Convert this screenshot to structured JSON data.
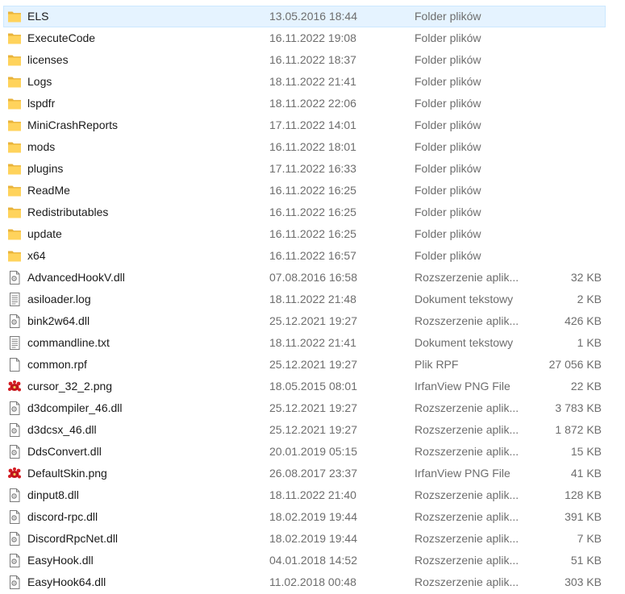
{
  "files": [
    {
      "name": "ELS",
      "date": "13.05.2016 18:44",
      "type": "Folder plików",
      "size": "",
      "icon": "folder-icon",
      "selected": true
    },
    {
      "name": "ExecuteCode",
      "date": "16.11.2022 19:08",
      "type": "Folder plików",
      "size": "",
      "icon": "folder-icon"
    },
    {
      "name": "licenses",
      "date": "16.11.2022 18:37",
      "type": "Folder plików",
      "size": "",
      "icon": "folder-icon"
    },
    {
      "name": "Logs",
      "date": "18.11.2022 21:41",
      "type": "Folder plików",
      "size": "",
      "icon": "folder-icon"
    },
    {
      "name": "lspdfr",
      "date": "18.11.2022 22:06",
      "type": "Folder plików",
      "size": "",
      "icon": "folder-icon"
    },
    {
      "name": "MiniCrashReports",
      "date": "17.11.2022 14:01",
      "type": "Folder plików",
      "size": "",
      "icon": "folder-icon"
    },
    {
      "name": "mods",
      "date": "16.11.2022 18:01",
      "type": "Folder plików",
      "size": "",
      "icon": "folder-icon"
    },
    {
      "name": "plugins",
      "date": "17.11.2022 16:33",
      "type": "Folder plików",
      "size": "",
      "icon": "folder-icon"
    },
    {
      "name": "ReadMe",
      "date": "16.11.2022 16:25",
      "type": "Folder plików",
      "size": "",
      "icon": "folder-icon"
    },
    {
      "name": "Redistributables",
      "date": "16.11.2022 16:25",
      "type": "Folder plików",
      "size": "",
      "icon": "folder-icon"
    },
    {
      "name": "update",
      "date": "16.11.2022 16:25",
      "type": "Folder plików",
      "size": "",
      "icon": "folder-icon"
    },
    {
      "name": "x64",
      "date": "16.11.2022 16:57",
      "type": "Folder plików",
      "size": "",
      "icon": "folder-icon"
    },
    {
      "name": "AdvancedHookV.dll",
      "date": "07.08.2016 16:58",
      "type": "Rozszerzenie aplik...",
      "size": "32 KB",
      "icon": "dll-file-icon"
    },
    {
      "name": "asiloader.log",
      "date": "18.11.2022 21:48",
      "type": "Dokument tekstowy",
      "size": "2 KB",
      "icon": "text-file-icon"
    },
    {
      "name": "bink2w64.dll",
      "date": "25.12.2021 19:27",
      "type": "Rozszerzenie aplik...",
      "size": "426 KB",
      "icon": "dll-file-icon"
    },
    {
      "name": "commandline.txt",
      "date": "18.11.2022 21:41",
      "type": "Dokument tekstowy",
      "size": "1 KB",
      "icon": "text-file-icon"
    },
    {
      "name": "common.rpf",
      "date": "25.12.2021 19:27",
      "type": "Plik RPF",
      "size": "27 056 KB",
      "icon": "blank-file-icon"
    },
    {
      "name": "cursor_32_2.png",
      "date": "18.05.2015 08:01",
      "type": "IrfanView PNG File",
      "size": "22 KB",
      "icon": "irfanview-icon"
    },
    {
      "name": "d3dcompiler_46.dll",
      "date": "25.12.2021 19:27",
      "type": "Rozszerzenie aplik...",
      "size": "3 783 KB",
      "icon": "dll-file-icon"
    },
    {
      "name": "d3dcsx_46.dll",
      "date": "25.12.2021 19:27",
      "type": "Rozszerzenie aplik...",
      "size": "1 872 KB",
      "icon": "dll-file-icon"
    },
    {
      "name": "DdsConvert.dll",
      "date": "20.01.2019 05:15",
      "type": "Rozszerzenie aplik...",
      "size": "15 KB",
      "icon": "dll-file-icon"
    },
    {
      "name": "DefaultSkin.png",
      "date": "26.08.2017 23:37",
      "type": "IrfanView PNG File",
      "size": "41 KB",
      "icon": "irfanview-icon"
    },
    {
      "name": "dinput8.dll",
      "date": "18.11.2022 21:40",
      "type": "Rozszerzenie aplik...",
      "size": "128 KB",
      "icon": "dll-file-icon"
    },
    {
      "name": "discord-rpc.dll",
      "date": "18.02.2019 19:44",
      "type": "Rozszerzenie aplik...",
      "size": "391 KB",
      "icon": "dll-file-icon"
    },
    {
      "name": "DiscordRpcNet.dll",
      "date": "18.02.2019 19:44",
      "type": "Rozszerzenie aplik...",
      "size": "7 KB",
      "icon": "dll-file-icon"
    },
    {
      "name": "EasyHook.dll",
      "date": "04.01.2018 14:52",
      "type": "Rozszerzenie aplik...",
      "size": "51 KB",
      "icon": "dll-file-icon"
    },
    {
      "name": "EasyHook64.dll",
      "date": "11.02.2018 00:48",
      "type": "Rozszerzenie aplik...",
      "size": "303 KB",
      "icon": "dll-file-icon"
    }
  ]
}
